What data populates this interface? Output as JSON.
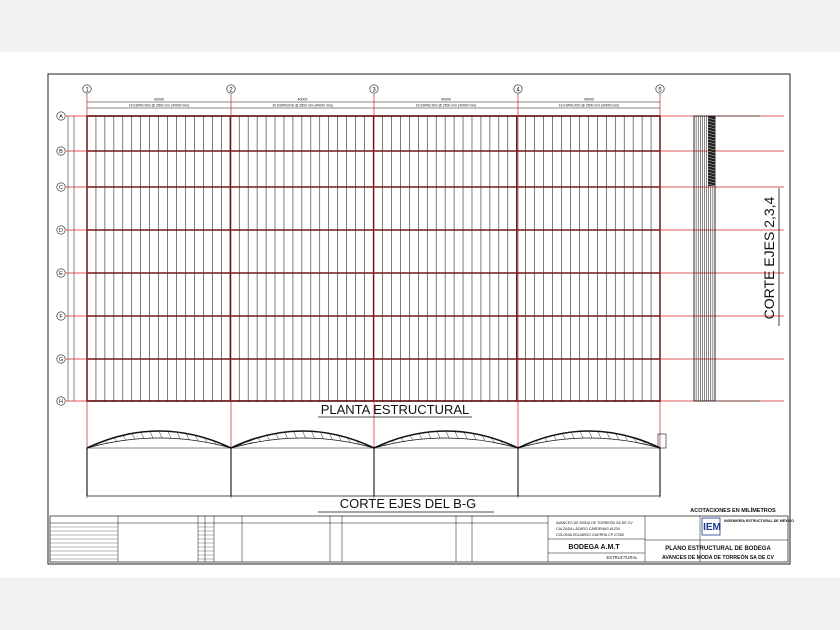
{
  "drawing": {
    "column_axes": [
      "1",
      "2",
      "3",
      "4",
      "5"
    ],
    "row_axes": [
      "A",
      "B",
      "C",
      "D",
      "E",
      "F",
      "G",
      "H"
    ],
    "bay_dimensions": [
      "40000",
      "40000",
      "40000",
      "40000"
    ],
    "spacing_notes": [
      "16 ESPACIOS @ 2500 mm (40000 mm)",
      "16 ESPACIOS @ 2500 mm (40000 mm)",
      "16 ESPACIOS @ 2500 mm (40000 mm)",
      "16 ESPACIOS @ 2500 mm (40000 mm)"
    ],
    "plan_title": "PLANTA ESTRUCTURAL",
    "section_title": "CORTE EJES DEL B-G",
    "side_section_title": "CORTE EJES 2,3,4",
    "units_note": "ACOTACIONES EN MILÍMETROS",
    "colors": {
      "grid": "#d22020",
      "lines": "#111111",
      "sheet": "#ffffff",
      "background": "#f2f2f2"
    }
  },
  "title_block": {
    "client_lines": [
      "AVANCES DE MODA DE TORREÓN SA DE CV",
      "CALZADA LÁZARO CÁRDENAS #1234",
      "COLONIA EDUARDO GUERRA  CP 27280"
    ],
    "project": "BODEGA A.M.T",
    "sheet_type": "ESTRUCTURAL",
    "company": "INGENIERÍA ESTRUCTURAL DE MÉXICO",
    "plan_name": "PLANO ESTRUCTURAL DE BODEGA",
    "plan_client": "AVANCES DE MODA DE TORREÓN SA DE CV"
  }
}
